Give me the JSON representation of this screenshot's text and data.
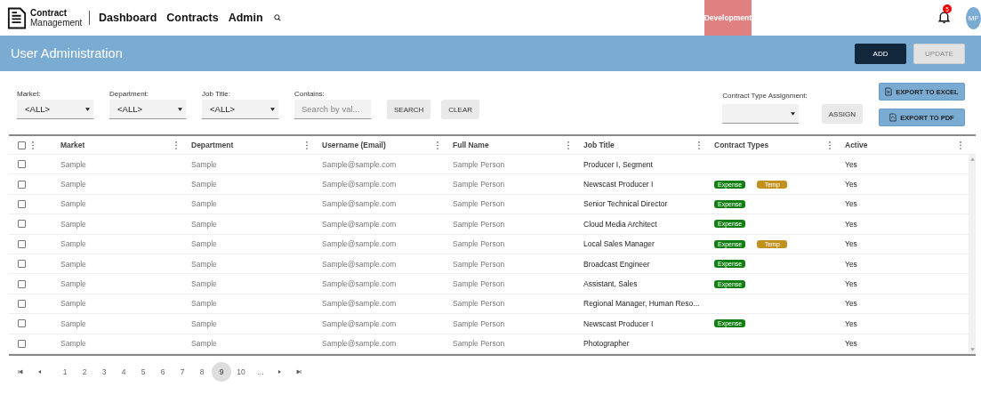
{
  "header": {
    "logo": {
      "line1": "Contract",
      "line2": "Management"
    },
    "nav": [
      "Dashboard",
      "Contracts",
      "Admin"
    ],
    "environment": "Development",
    "notifications": "5",
    "avatar": "MF"
  },
  "banner": {
    "title": "User Administration",
    "buttons": [
      {
        "label": "ADD",
        "disabled": false
      },
      {
        "label": "UPDATE",
        "disabled": true
      }
    ]
  },
  "filters": [
    {
      "label": "Market:",
      "value": "<ALL>"
    },
    {
      "label": "Department:",
      "value": "<ALL>"
    },
    {
      "label": "Job Title:",
      "value": "<ALL>"
    }
  ],
  "contains": {
    "label": "Contains:",
    "placeholder": "Search by val..."
  },
  "filter_buttons": [
    "SEARCH",
    "CLEAR"
  ],
  "assignment": {
    "label": "Contract Type Assignment:",
    "button": "ASSIGN"
  },
  "exports": [
    {
      "label": "EXPORT TO EXCEL",
      "kind": "excel"
    },
    {
      "label": "EXPORT TO PDF",
      "kind": "pdf"
    }
  ],
  "table": {
    "all_checked": false,
    "columns": [
      "Market",
      "Department",
      "Username (Email)",
      "Full Name",
      "Job Title",
      "Contract Types",
      "Active"
    ],
    "rows": [
      {
        "checked": false,
        "cells": [
          "Sample",
          "Sample",
          "Sample@sample.com",
          "Sample Person",
          "Producer I, Segment"
        ],
        "tags": [],
        "active": "Yes"
      },
      {
        "checked": false,
        "cells": [
          "Sample",
          "Sample",
          "Sample@sample.com",
          "Sample Person",
          "Newscast Producer I"
        ],
        "tags": [
          {
            "label": "Expense",
            "color": "#127f12"
          },
          {
            "label": "Temp",
            "color": "#c1901f"
          }
        ],
        "active": "Yes"
      },
      {
        "checked": false,
        "cells": [
          "Sample",
          "Sample",
          "Sample@sample.com",
          "Sample Person",
          "Senior Technical Director"
        ],
        "tags": [
          {
            "label": "Expense",
            "color": "#127f12"
          }
        ],
        "active": "Yes"
      },
      {
        "checked": false,
        "cells": [
          "Sample",
          "Sample",
          "Sample@sample.com",
          "Sample Person",
          "Cloud Media Architect"
        ],
        "tags": [
          {
            "label": "Expense",
            "color": "#127f12"
          }
        ],
        "active": "Yes"
      },
      {
        "checked": false,
        "cells": [
          "Sample",
          "Sample",
          "Sample@sample.com",
          "Sample Person",
          "Local Sales Manager"
        ],
        "tags": [
          {
            "label": "Expense",
            "color": "#127f12"
          },
          {
            "label": "Temp",
            "color": "#c1901f"
          }
        ],
        "active": "Yes"
      },
      {
        "checked": false,
        "cells": [
          "Sample",
          "Sample",
          "Sample@sample.com",
          "Sample Person",
          "Broadcast Engineer"
        ],
        "tags": [
          {
            "label": "Expense",
            "color": "#127f12"
          }
        ],
        "active": "Yes"
      },
      {
        "checked": false,
        "cells": [
          "Sample",
          "Sample",
          "Sample@sample.com",
          "Sample Person",
          "Assistant, Sales"
        ],
        "tags": [
          {
            "label": "Expense",
            "color": "#127f12"
          }
        ],
        "active": "Yes"
      },
      {
        "checked": false,
        "cells": [
          "Sample",
          "Sample",
          "Sample@sample.com",
          "Sample Person",
          "Regional Manager, Human Reso..."
        ],
        "tags": [],
        "active": "Yes"
      },
      {
        "checked": false,
        "cells": [
          "Sample",
          "Sample",
          "Sample@sample.com",
          "Sample Person",
          "Newscast Producer I"
        ],
        "tags": [
          {
            "label": "Expense",
            "color": "#127f12"
          }
        ],
        "active": "Yes"
      },
      {
        "checked": false,
        "cells": [
          "Sample",
          "Sample",
          "Sample@sample.com",
          "Sample Person",
          "Photographer"
        ],
        "tags": [],
        "active": "Yes"
      }
    ]
  },
  "pagination": {
    "pages": [
      {
        "label": "1",
        "selected": false
      },
      {
        "label": "2",
        "selected": false
      },
      {
        "label": "3",
        "selected": false
      },
      {
        "label": "4",
        "selected": false
      },
      {
        "label": "5",
        "selected": false
      },
      {
        "label": "6",
        "selected": false
      },
      {
        "label": "7",
        "selected": false
      },
      {
        "label": "8",
        "selected": false
      },
      {
        "label": "9",
        "selected": true
      },
      {
        "label": "10",
        "selected": false
      },
      {
        "label": "...",
        "selected": false
      }
    ]
  }
}
